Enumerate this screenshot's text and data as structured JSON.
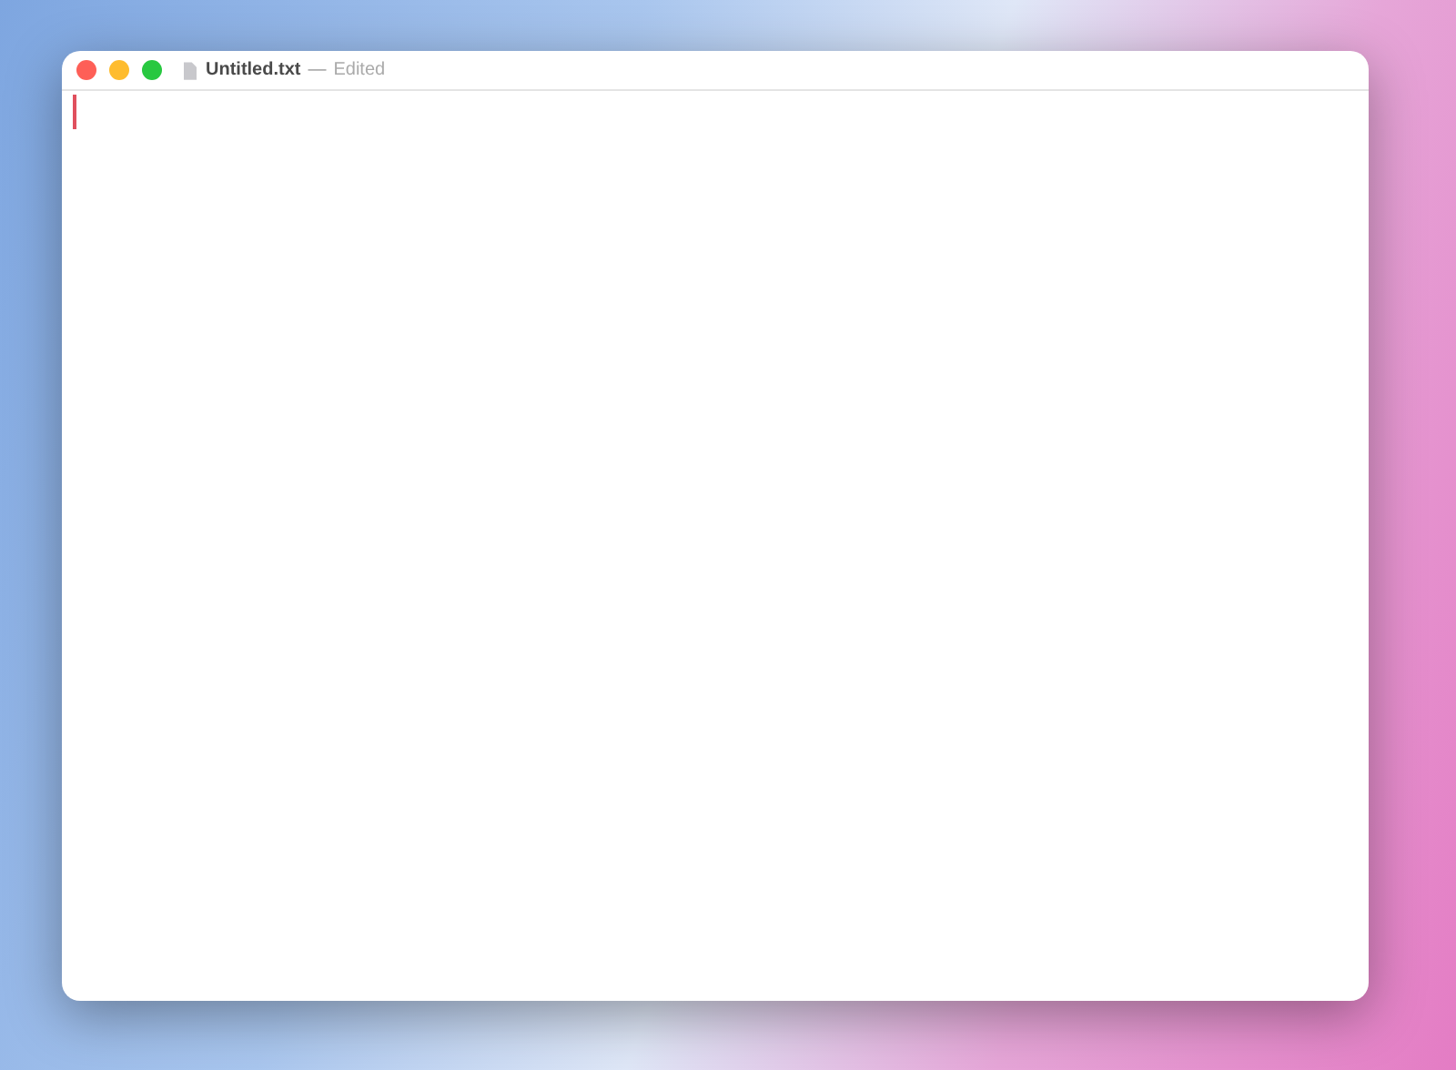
{
  "window": {
    "title": "Untitled.txt",
    "separator": "—",
    "status": "Edited"
  }
}
